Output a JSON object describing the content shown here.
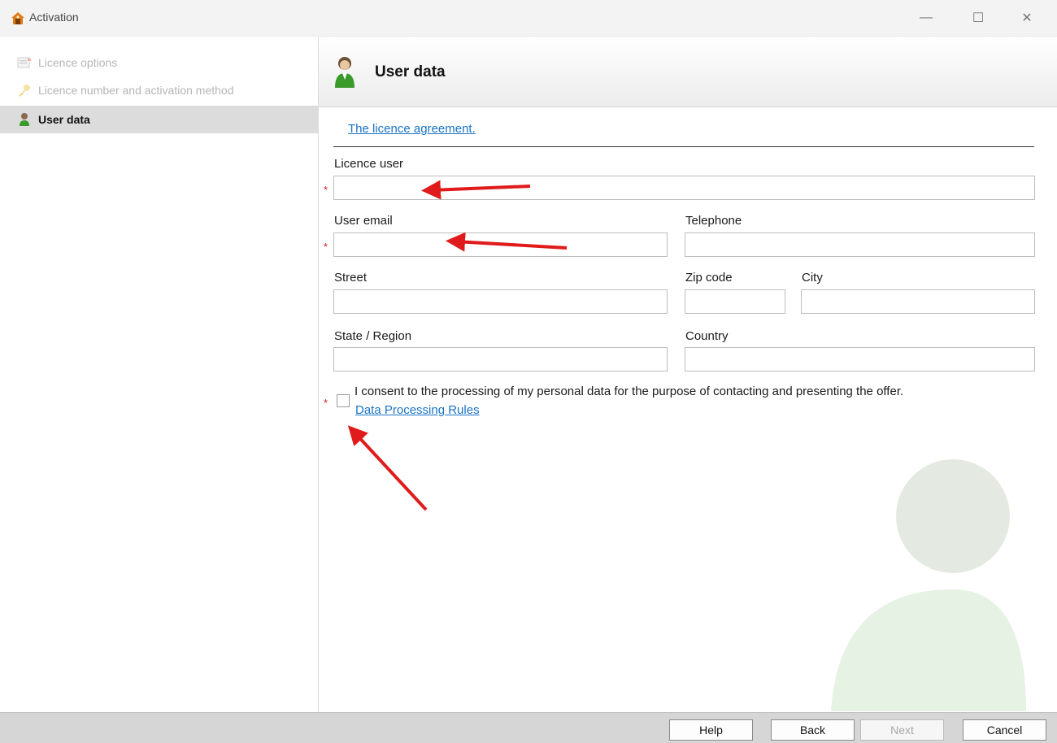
{
  "window": {
    "title": "Activation",
    "icon": "activation-app-icon",
    "controls": {
      "minimize": "—",
      "maximize": "☐",
      "close": "✕"
    }
  },
  "sidebar": {
    "items": [
      {
        "label": "Licence options",
        "icon": "document-icon",
        "state": "disabled"
      },
      {
        "label": "Licence number and activation method",
        "icon": "key-icon",
        "state": "disabled"
      },
      {
        "label": "User data",
        "icon": "user-icon",
        "state": "active"
      }
    ]
  },
  "main": {
    "header_title": "User data",
    "licence_link": "The licence agreement.",
    "fields": {
      "licence_user": {
        "label": "Licence user",
        "value": "",
        "required": true
      },
      "user_email": {
        "label": "User email",
        "value": "",
        "required": true
      },
      "telephone": {
        "label": "Telephone",
        "value": ""
      },
      "street": {
        "label": "Street",
        "value": ""
      },
      "zip_code": {
        "label": "Zip code",
        "value": ""
      },
      "city": {
        "label": "City",
        "value": ""
      },
      "state_region": {
        "label": "State / Region",
        "value": ""
      },
      "country": {
        "label": "Country",
        "value": ""
      }
    },
    "required_marker": "*",
    "consent": {
      "text": "I consent to the processing of my personal data for the purpose of contacting and presenting the offer.",
      "link": "Data Processing Rules",
      "checked": false,
      "required": true
    }
  },
  "footer": {
    "help": "Help",
    "back": "Back",
    "next": "Next",
    "cancel": "Cancel",
    "next_disabled": true
  },
  "colors": {
    "link": "#1a73c4",
    "required": "#d02020",
    "annotation_arrow": "#e01b1b",
    "user_icon_green": "#3a9a2a"
  }
}
